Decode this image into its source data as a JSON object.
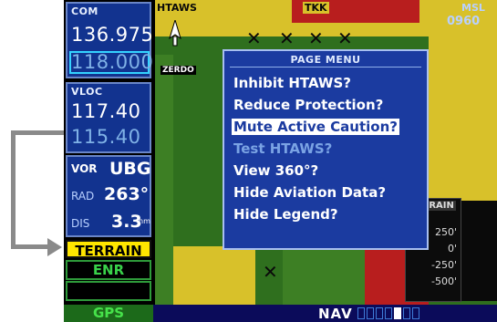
{
  "com": {
    "label": "COM",
    "active": "136.975",
    "standby": "118.000"
  },
  "vloc": {
    "label": "VLOC",
    "active": "117.40",
    "standby": "115.40"
  },
  "vor": {
    "label": "VOR",
    "id": "UBG",
    "rad_label": "RAD",
    "rad_value": "263°",
    "dis_label": "DIS",
    "dis_value": "3.3",
    "dis_unit": "nm"
  },
  "terrain_badge": "TERRAIN",
  "mode": "ENR",
  "bottom": {
    "gps": "GPS",
    "nav": "NAV"
  },
  "map": {
    "labels": [
      "HTAWS",
      "TKK",
      "MSL",
      "0960",
      "ZERDO"
    ],
    "aircraft_icon": "aircraft-icon",
    "obstacle_icon": "obstacle-icon"
  },
  "legend": {
    "title": "TERRAIN",
    "rows": [
      "250'",
      "0'",
      "-250'",
      "-500'"
    ]
  },
  "menu": {
    "title": "PAGE MENU",
    "items": [
      {
        "label": "Inhibit HTAWS?",
        "state": "normal"
      },
      {
        "label": "Reduce Protection?",
        "state": "normal"
      },
      {
        "label": "Mute Active Caution?",
        "state": "selected"
      },
      {
        "label": "Test HTAWS?",
        "state": "disabled"
      },
      {
        "label": "View 360°?",
        "state": "normal"
      },
      {
        "label": "Hide Aviation Data?",
        "state": "normal"
      },
      {
        "label": "Hide Legend?",
        "state": "normal"
      }
    ]
  },
  "page_indicator": {
    "total": 7,
    "active_index": 4
  },
  "colors": {
    "menu_bg": "#1b3ba0",
    "terrain_badge": "#ffe600",
    "gps_green": "#46e24a"
  }
}
